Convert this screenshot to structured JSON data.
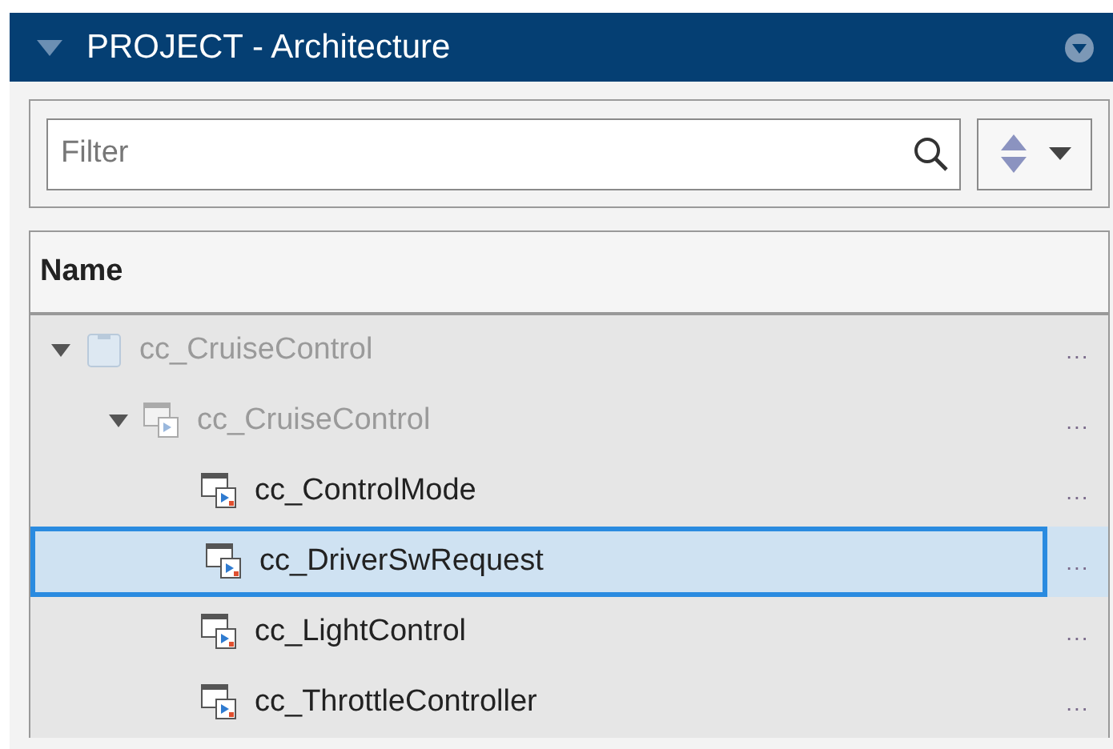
{
  "panel": {
    "title": "PROJECT - Architecture"
  },
  "filter": {
    "placeholder": "Filter"
  },
  "table": {
    "columns": [
      "Name"
    ],
    "tree": [
      {
        "label": "cc_CruiseControl",
        "kind": "project",
        "expanded": true,
        "disabled": true,
        "selected": false,
        "menu": "...",
        "children": [
          {
            "label": "cc_CruiseControl",
            "kind": "composition",
            "expanded": true,
            "disabled": true,
            "selected": false,
            "menu": "...",
            "children": [
              {
                "label": "cc_ControlMode",
                "kind": "component",
                "disabled": false,
                "selected": false,
                "menu": "..."
              },
              {
                "label": "cc_DriverSwRequest",
                "kind": "component",
                "disabled": false,
                "selected": true,
                "menu": "..."
              },
              {
                "label": "cc_LightControl",
                "kind": "component",
                "disabled": false,
                "selected": false,
                "menu": "..."
              },
              {
                "label": "cc_ThrottleController",
                "kind": "component",
                "disabled": false,
                "selected": false,
                "menu": "..."
              }
            ]
          }
        ]
      }
    ]
  }
}
